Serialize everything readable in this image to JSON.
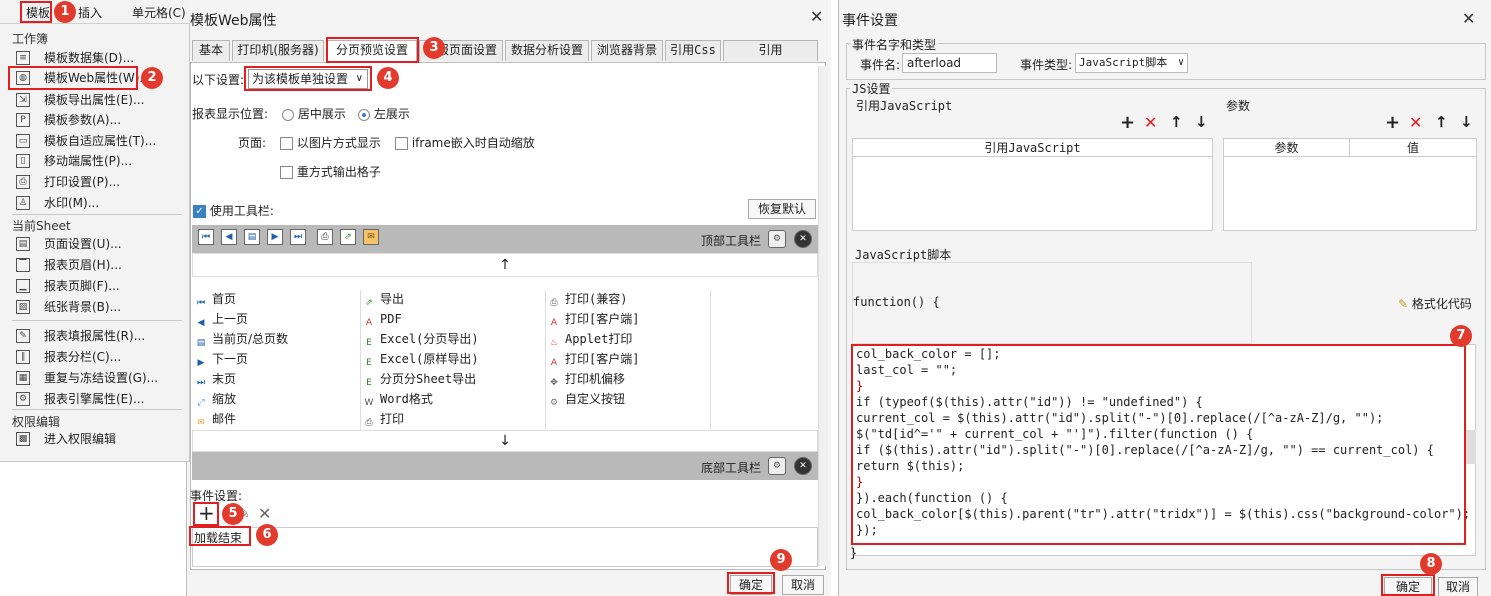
{
  "menu": {
    "bar": {
      "template": "模板",
      "insert": "插入",
      "cell": "单元格(C)"
    },
    "sections": {
      "workbook": "工作簿",
      "sheet": "当前Sheet",
      "permission": "权限编辑"
    },
    "workbook_items": [
      {
        "icon": "database-icon",
        "label": "模板数据集(D)..."
      },
      {
        "icon": "globe-icon",
        "label": "模板Web属性(W)..."
      },
      {
        "icon": "export-icon",
        "label": "模板导出属性(E)..."
      },
      {
        "icon": "param-icon",
        "label": "模板参数(A)..."
      },
      {
        "icon": "adaptive-icon",
        "label": "模板自适应属性(T)..."
      },
      {
        "icon": "mobile-icon",
        "label": "移动端属性(P)..."
      },
      {
        "icon": "printer-icon",
        "label": "打印设置(P)..."
      },
      {
        "icon": "stamp-icon",
        "label": "水印(M)..."
      }
    ],
    "sheet_items": [
      {
        "icon": "page-icon",
        "label": "页面设置(U)..."
      },
      {
        "icon": "header-icon",
        "label": "报表页眉(H)..."
      },
      {
        "icon": "footer-icon",
        "label": "报表页脚(F)..."
      },
      {
        "icon": "image-icon",
        "label": "纸张背景(B)..."
      }
    ],
    "sheet_items2": [
      {
        "icon": "fill-icon",
        "label": "报表填报属性(R)..."
      },
      {
        "icon": "columns-icon",
        "label": "报表分栏(C)..."
      },
      {
        "icon": "freeze-icon",
        "label": "重复与冻结设置(G)..."
      },
      {
        "icon": "engine-icon",
        "label": "报表引擎属性(E)..."
      }
    ],
    "permission_items": [
      {
        "icon": "permission-icon",
        "label": "进入权限编辑"
      }
    ]
  },
  "dialog1": {
    "title": "模板Web属性",
    "tabs": [
      "基本",
      "打印机(服务器)",
      "分页预览设置",
      "填报页面设置",
      "数据分析设置",
      "浏览器背景",
      "引用Css",
      "引用JavaScript"
    ],
    "settings_label": "以下设置:",
    "settings_value": "为该模板单独设置",
    "display_label": "报表显示位置:",
    "radio_center": "居中展示",
    "radio_left": "左展示",
    "page_label": "页面:",
    "opt_image": "以图片方式显示",
    "opt_iframe": "iframe嵌入时自动缩放",
    "opt_reprint": "重方式输出格子",
    "use_toolbar": "使用工具栏:",
    "restore_default": "恢复默认",
    "top_toolbar": "顶部工具栏",
    "bottom_toolbar": "底部工具栏",
    "arrow_up": "↑",
    "arrow_down": "↓",
    "buttons_col1": [
      "首页",
      "上一页",
      "当前页/总页数",
      "下一页",
      "末页",
      "缩放",
      "邮件"
    ],
    "buttons_col2": [
      "导出",
      "PDF",
      "Excel(分页导出)",
      "Excel(原样导出)",
      "分页分Sheet导出",
      "Word格式",
      "打印"
    ],
    "buttons_col3": [
      "打印(兼容)",
      "打印[客户端]",
      "Applet打印",
      "打印[客户端]",
      "打印机偏移",
      "自定义按钮"
    ],
    "event_label": "事件设置:",
    "event_item": "加载结束",
    "ok": "确定",
    "cancel": "取消"
  },
  "dialog2": {
    "title": "事件设置",
    "group_name": "事件名字和类型",
    "event_name_label": "事件名:",
    "event_name_value": "afterload",
    "event_type_label": "事件类型:",
    "event_type_value": "JavaScript脚本",
    "js_group": "JS设置",
    "ref_js_label": "引用JavaScript",
    "param_label": "参数",
    "col_ref_js": "引用JavaScript",
    "col_param": "参数",
    "col_value": "值",
    "script_label": "JavaScript脚本",
    "func_head": "function() {",
    "format_code": "格式化代码",
    "code_lines": [
      "col_back_color = [];",
      "last_col = \"\";",
      "}",
      "if (typeof($(this).attr(\"id\")) != \"undefined\") {",
      "current_col = $(this).attr(\"id\").split(\"-\")[0].replace(/[^a-zA-Z]/g, \"\");",
      "$(\"td[id^='\" + current_col + \"']\").filter(function () {",
      "if ($(this).attr(\"id\").split(\"-\")[0].replace(/[^a-zA-Z]/g, \"\") == current_col) {",
      "return $(this);",
      "}",
      "}).each(function () {",
      "col_back_color[$(this).parent(\"tr\").attr(\"tridx\")] = $(this).css(\"background-color\");",
      "});"
    ],
    "func_tail": "}",
    "ok": "确定",
    "cancel": "取消"
  },
  "badges": [
    "1",
    "2",
    "3",
    "4",
    "5",
    "6",
    "7",
    "8",
    "9"
  ],
  "colors": {
    "highlight": "#e02020",
    "badge": "#e23b2e",
    "toolbar": "#b9b9b9"
  }
}
